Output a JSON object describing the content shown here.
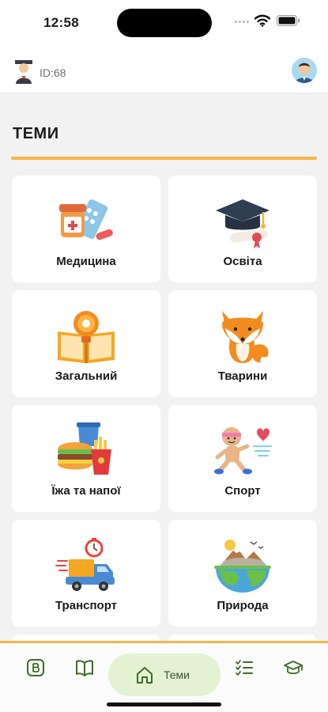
{
  "status_bar": {
    "time": "12:58"
  },
  "header": {
    "user_id": "ID:68"
  },
  "section": {
    "title": "ТЕМИ"
  },
  "topics": [
    {
      "label": "Медицина",
      "icon": "medicine-icon"
    },
    {
      "label": "Освіта",
      "icon": "graduation-cap-icon"
    },
    {
      "label": "Загальний",
      "icon": "book-bulb-icon"
    },
    {
      "label": "Тварини",
      "icon": "fox-icon"
    },
    {
      "label": "Їжа та напої",
      "icon": "food-drink-icon"
    },
    {
      "label": "Спорт",
      "icon": "runner-icon"
    },
    {
      "label": "Транспорт",
      "icon": "delivery-truck-icon"
    },
    {
      "label": "Природа",
      "icon": "nature-globe-icon"
    }
  ],
  "bottom_nav": {
    "active_label": "Теми",
    "items": [
      "vocabulary-b-icon",
      "book-icon",
      "home-icon",
      "checklist-icon",
      "graduation-icon"
    ]
  },
  "colors": {
    "accent": "#f7b548",
    "nav_active_bg": "#e4f2d3",
    "nav_icon": "#3f6b2a"
  }
}
